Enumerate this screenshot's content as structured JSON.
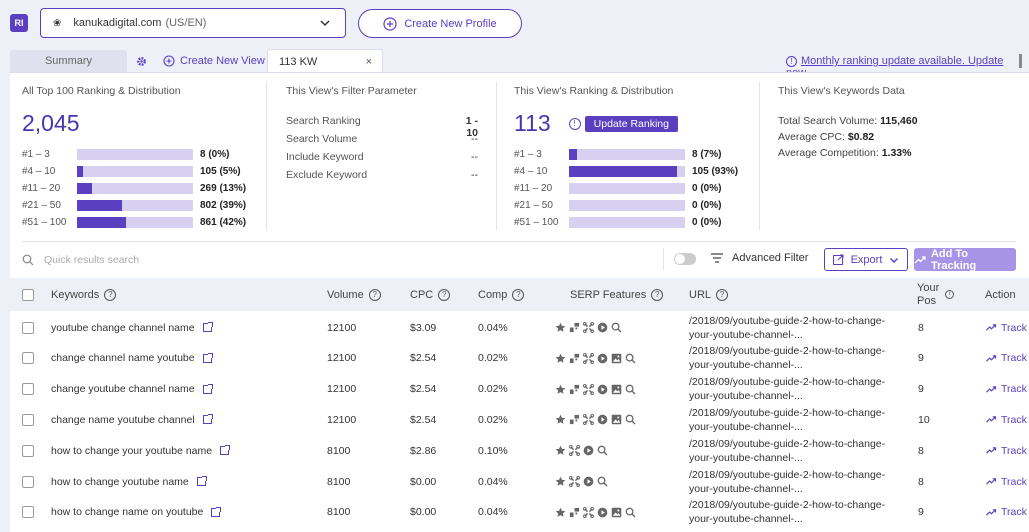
{
  "logo": "RI",
  "site": {
    "name": "kanukadigital.com",
    "locale": "(US/EN)"
  },
  "create_profile": "Create New Profile",
  "tabs": {
    "summary": "Summary",
    "create_view": "Create New View",
    "active": "113 KW",
    "close": "×"
  },
  "update_notice": "Monthly ranking update available. Update now.",
  "stats": {
    "all": {
      "title": "All Top 100 Ranking & Distribution",
      "total": "2,045",
      "rows": [
        {
          "label": "#1 – 3",
          "value": "8 (0%)",
          "pct": 0
        },
        {
          "label": "#4 – 10",
          "value": "105 (5%)",
          "pct": 5
        },
        {
          "label": "#11 – 20",
          "value": "269 (13%)",
          "pct": 13
        },
        {
          "label": "#21 – 50",
          "value": "802 (39%)",
          "pct": 39
        },
        {
          "label": "#51 – 100",
          "value": "861 (42%)",
          "pct": 42
        }
      ]
    },
    "filter": {
      "title": "This View's Filter Parameter",
      "rows": [
        {
          "key": "Search Ranking",
          "value": "1 - 10"
        },
        {
          "key": "Search Volume",
          "value": "--"
        },
        {
          "key": "Include Keyword",
          "value": "--"
        },
        {
          "key": "Exclude Keyword",
          "value": "--"
        }
      ]
    },
    "view": {
      "title": "This View's Ranking & Distribution",
      "total": "113",
      "update_button": "Update Ranking",
      "rows": [
        {
          "label": "#1 – 3",
          "value": "8 (7%)",
          "pct": 7
        },
        {
          "label": "#4 – 10",
          "value": "105 (93%)",
          "pct": 93
        },
        {
          "label": "#11 – 20",
          "value": "0 (0%)",
          "pct": 0
        },
        {
          "label": "#21 – 50",
          "value": "0 (0%)",
          "pct": 0
        },
        {
          "label": "#51 – 100",
          "value": "0 (0%)",
          "pct": 0
        }
      ]
    },
    "kwdata": {
      "title": "This View's Keywords Data",
      "rows": [
        {
          "key": "Total Search Volume:",
          "value": "115,460"
        },
        {
          "key": "Average CPC:",
          "value": "$0.82"
        },
        {
          "key": "Average Competition:",
          "value": "1.33%"
        }
      ]
    }
  },
  "toolbar": {
    "search_placeholder": "Quick results search",
    "advanced_filter": "Advanced Filter",
    "export": "Export",
    "add_tracking": "Add To Tracking"
  },
  "table": {
    "headers": {
      "keywords": "Keywords",
      "volume": "Volume",
      "cpc": "CPC",
      "comp": "Comp",
      "serp": "SERP Features",
      "url": "URL",
      "pos": "Your Pos",
      "action": "Action"
    },
    "rows": [
      {
        "keyword": "youtube change channel name",
        "volume": "12100",
        "cpc": "$3.09",
        "comp": "0.04%",
        "serp": [
          "star-icon",
          "sitelinks-icon",
          "puzzle-icon",
          "video-icon",
          "search-icon"
        ],
        "url1": "/2018/09/youtube-guide-2-how-to-change-",
        "url2": "your-youtube-channel-...",
        "pos": "8",
        "action": "Track"
      },
      {
        "keyword": "change channel name youtube",
        "volume": "12100",
        "cpc": "$2.54",
        "comp": "0.02%",
        "serp": [
          "star-icon",
          "sitelinks-icon",
          "puzzle-icon",
          "video-icon",
          "image-icon",
          "search-icon"
        ],
        "url1": "/2018/09/youtube-guide-2-how-to-change-",
        "url2": "your-youtube-channel-...",
        "pos": "9",
        "action": "Track"
      },
      {
        "keyword": "change youtube channel name",
        "volume": "12100",
        "cpc": "$2.54",
        "comp": "0.02%",
        "serp": [
          "star-icon",
          "sitelinks-icon",
          "puzzle-icon",
          "video-icon",
          "image-icon",
          "search-icon"
        ],
        "url1": "/2018/09/youtube-guide-2-how-to-change-",
        "url2": "your-youtube-channel-...",
        "pos": "9",
        "action": "Track"
      },
      {
        "keyword": "change name youtube channel",
        "volume": "12100",
        "cpc": "$2.54",
        "comp": "0.02%",
        "serp": [
          "star-icon",
          "sitelinks-icon",
          "puzzle-icon",
          "video-icon",
          "image-icon",
          "search-icon"
        ],
        "url1": "/2018/09/youtube-guide-2-how-to-change-",
        "url2": "your-youtube-channel-...",
        "pos": "10",
        "action": "Track"
      },
      {
        "keyword": "how to change your youtube name",
        "volume": "8100",
        "cpc": "$2.86",
        "comp": "0.10%",
        "serp": [
          "star-icon",
          "puzzle-icon",
          "video-icon",
          "search-icon"
        ],
        "url1": "/2018/09/youtube-guide-2-how-to-change-",
        "url2": "your-youtube-channel-...",
        "pos": "8",
        "action": "Track"
      },
      {
        "keyword": "how to change youtube name",
        "volume": "8100",
        "cpc": "$0.00",
        "comp": "0.04%",
        "serp": [
          "star-icon",
          "puzzle-icon",
          "video-icon",
          "search-icon"
        ],
        "url1": "/2018/09/youtube-guide-2-how-to-change-",
        "url2": "your-youtube-channel-...",
        "pos": "8",
        "action": "Track"
      },
      {
        "keyword": "how to change name on youtube",
        "volume": "8100",
        "cpc": "$0.00",
        "comp": "0.04%",
        "serp": [
          "star-icon",
          "sitelinks-icon",
          "puzzle-icon",
          "video-icon",
          "image-icon",
          "search-icon"
        ],
        "url1": "/2018/09/youtube-guide-2-how-to-change-",
        "url2": "your-youtube-channel-...",
        "pos": "9",
        "action": "Track"
      }
    ]
  },
  "colors": {
    "accent": "#5a3fc0",
    "bar_bg": "#d8d0f0",
    "header_bg": "#eef0f8"
  }
}
